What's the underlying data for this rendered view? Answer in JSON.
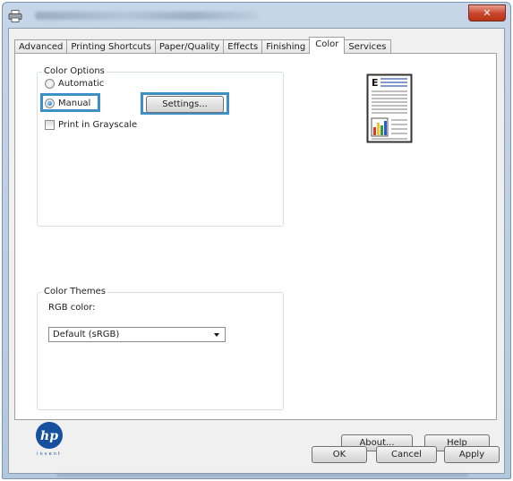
{
  "tabs": [
    {
      "label": "Advanced"
    },
    {
      "label": "Printing Shortcuts"
    },
    {
      "label": "Paper/Quality"
    },
    {
      "label": "Effects"
    },
    {
      "label": "Finishing"
    },
    {
      "label": "Color",
      "active": true
    },
    {
      "label": "Services"
    }
  ],
  "color_options": {
    "legend": "Color Options",
    "automatic_label": "Automatic",
    "manual_label": "Manual",
    "selected": "Manual",
    "settings_button": "Settings...",
    "grayscale_label": "Print in Grayscale",
    "grayscale_checked": false
  },
  "color_themes": {
    "legend": "Color Themes",
    "rgb_label": "RGB color:",
    "rgb_value": "Default (sRGB)"
  },
  "buttons": {
    "about": "About...",
    "help": "Help",
    "ok": "OK",
    "cancel": "Cancel",
    "apply": "Apply"
  },
  "logo": {
    "text": "invent"
  },
  "colors": {
    "highlight": "#3d8fc5",
    "close_button": "#c8452c",
    "hp_blue": "#16509e"
  },
  "icons": {
    "title": "printer-icon",
    "close": "close-icon",
    "dropdown": "chevron-down-icon",
    "preview": "document-preview-icon",
    "logo": "hp-logo-icon"
  }
}
